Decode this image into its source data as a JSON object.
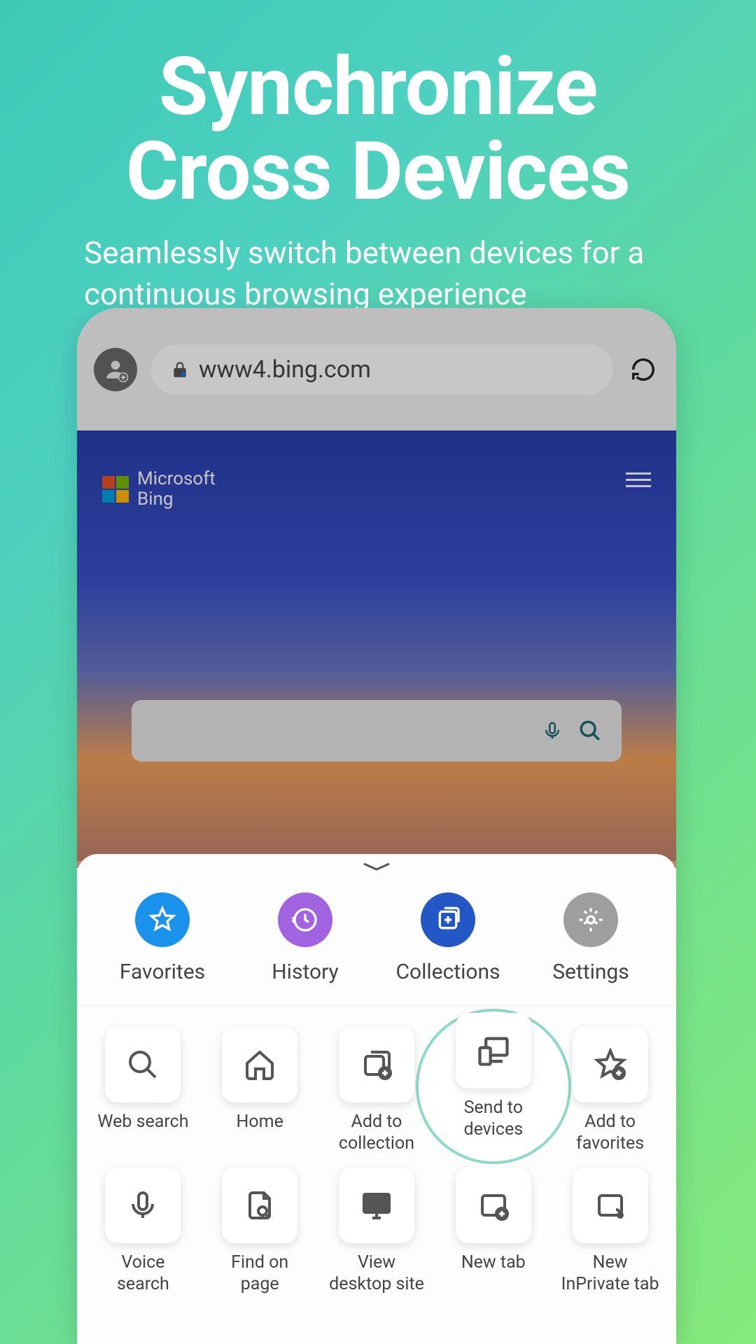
{
  "hero": {
    "title_line1": "Synchronize",
    "title_line2": "Cross Devices",
    "subtitle": "Seamlessly switch between devices for a continuous browsing experience"
  },
  "browser": {
    "url": "www4.bing.com",
    "brand_line1": "Microsoft",
    "brand_line2": "Bing"
  },
  "sheet": {
    "top": [
      {
        "label": "Favorites",
        "icon": "star-icon",
        "color": "blue"
      },
      {
        "label": "History",
        "icon": "history-icon",
        "color": "purple"
      },
      {
        "label": "Collections",
        "icon": "collections-icon",
        "color": "navy"
      },
      {
        "label": "Settings",
        "icon": "gear-icon",
        "color": "gray"
      }
    ],
    "grid_row1": [
      {
        "label": "Web search",
        "icon": "search-icon"
      },
      {
        "label": "Home",
        "icon": "home-icon"
      },
      {
        "label": "Add to collection",
        "icon": "add-collection-icon"
      },
      {
        "label": "Send to devices",
        "icon": "send-devices-icon",
        "highlight": true
      },
      {
        "label": "Add to favorites",
        "icon": "add-favorite-icon"
      }
    ],
    "grid_row2": [
      {
        "label": "Voice search",
        "icon": "mic-icon"
      },
      {
        "label": "Find on page",
        "icon": "find-page-icon"
      },
      {
        "label": "View desktop site",
        "icon": "desktop-icon"
      },
      {
        "label": "New tab",
        "icon": "new-tab-icon"
      },
      {
        "label": "New InPrivate tab",
        "icon": "inprivate-icon"
      }
    ]
  }
}
